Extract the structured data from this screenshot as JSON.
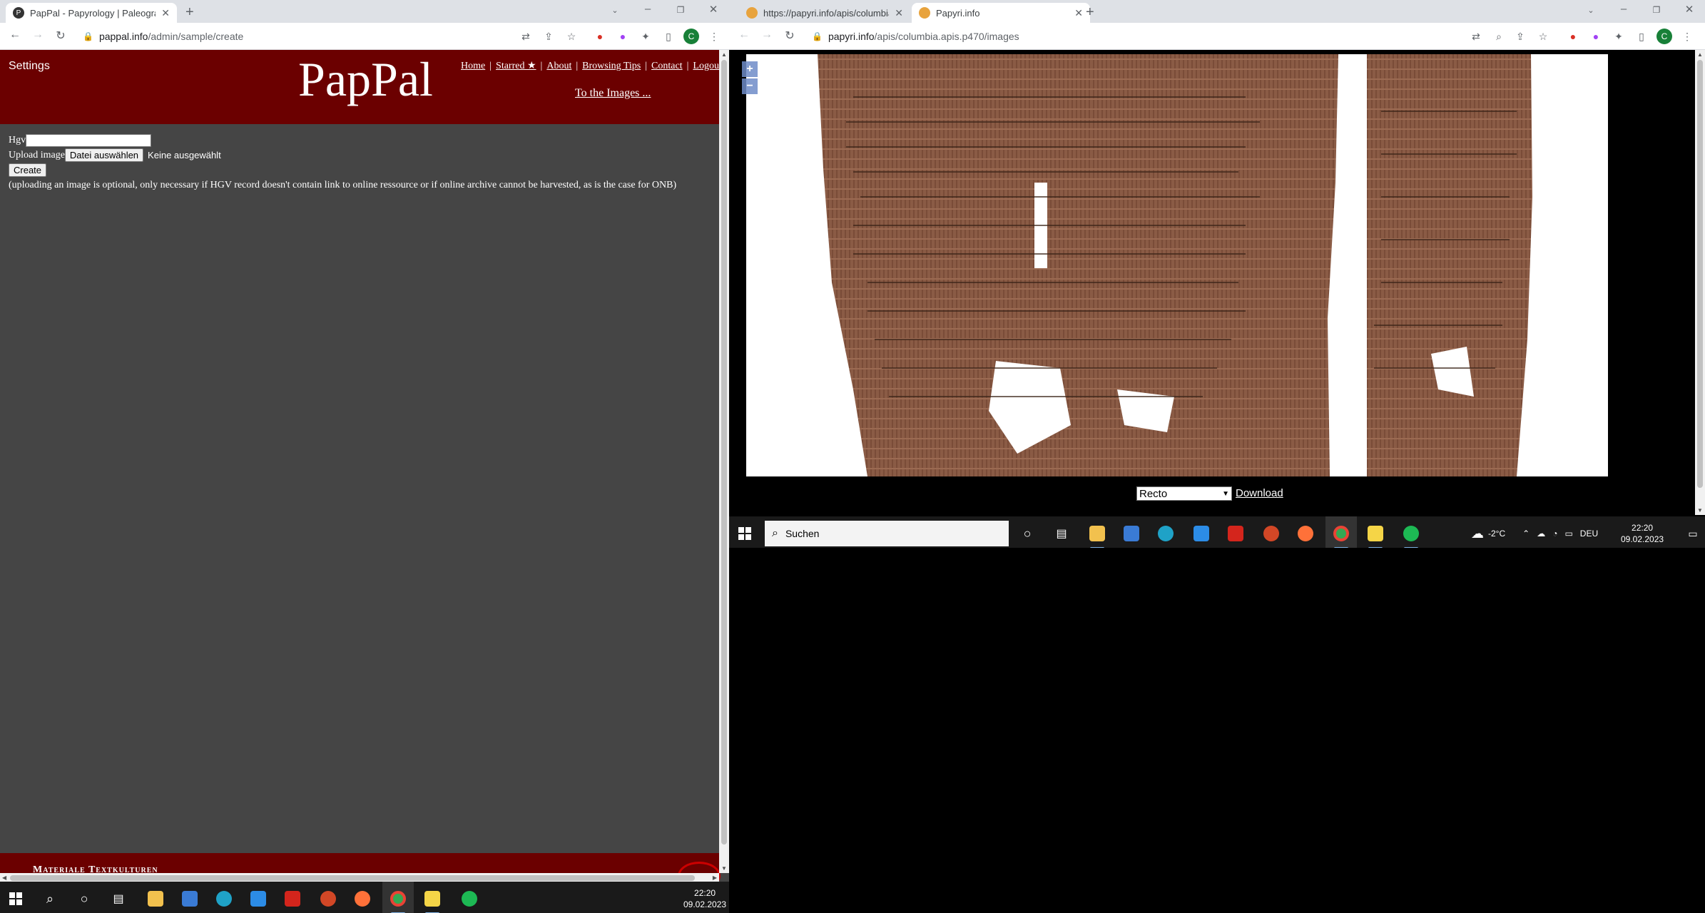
{
  "left_window": {
    "tab": {
      "title": "PapPal - Papyrology | Paleograph",
      "favicon": "pappal-icon"
    },
    "url": {
      "host": "pappal.info",
      "path": "/admin/sample/create"
    },
    "profile_letter": "C",
    "page": {
      "settings": "Settings",
      "logo": "PapPal",
      "nav": [
        {
          "label": "Home"
        },
        {
          "label": "Starred ★"
        },
        {
          "label": "About"
        },
        {
          "label": "Browsing Tips"
        },
        {
          "label": "Contact"
        },
        {
          "label": "Logout"
        }
      ],
      "to_images": "To the Images ...",
      "form": {
        "hgv_label": "Hgv",
        "hgv_value": "",
        "upload_label": "Upload image",
        "file_button": "Datei auswählen",
        "file_status": "Keine ausgewählt",
        "create_button": "Create",
        "note": "(uploading an image is optional, only necessary if HGV record doesn't contain link to online ressource or if online archive cannot be harvested, as is the case for ONB)"
      },
      "footer": "Materiale Textkulturen"
    },
    "taskbar": {
      "time": "22:20",
      "date": "09.02.2023"
    }
  },
  "right_window": {
    "tabs": [
      {
        "title": "https://papyri.info/apis/columbia",
        "active": false
      },
      {
        "title": "Papyri.info",
        "active": true
      }
    ],
    "url": {
      "host": "papyri.info",
      "path": "/apis/columbia.apis.p470/images"
    },
    "profile_letter": "C",
    "viewer": {
      "zoom_in": "+",
      "zoom_out": "−",
      "side_select": "Recto",
      "download": "Download"
    },
    "taskbar": {
      "search_placeholder": "Suchen",
      "weather": "-2°C",
      "lang": "DEU",
      "time": "22:20",
      "date": "09.02.2023"
    }
  },
  "colors": {
    "pappal_header": "#6b0000",
    "pappal_body": "#454545",
    "chrome_tabbar": "#dee1e6",
    "taskbar": "#1a1a1a"
  }
}
